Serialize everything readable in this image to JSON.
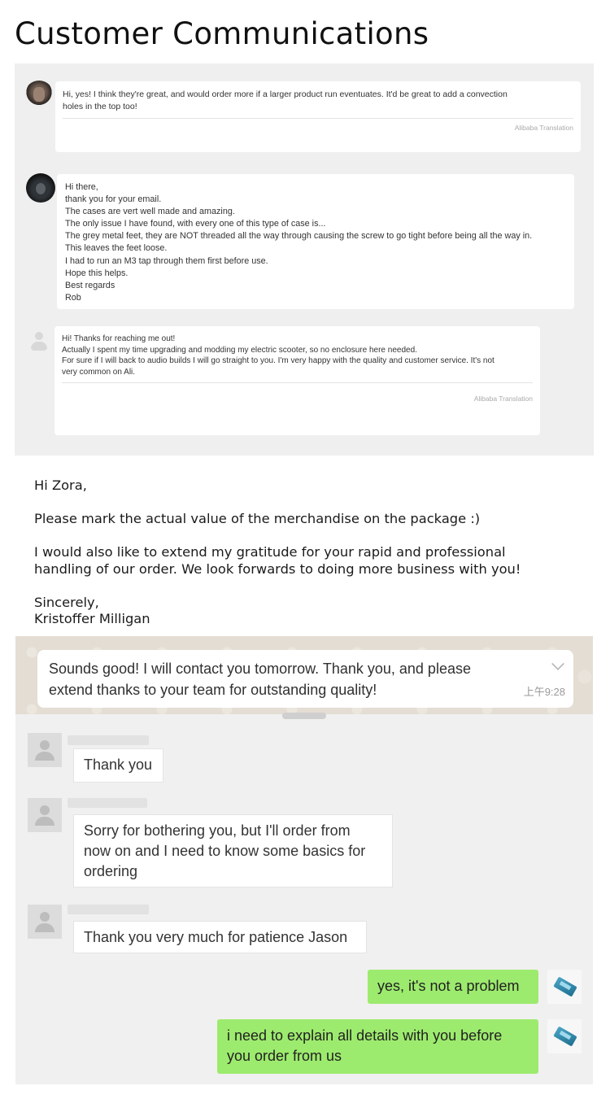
{
  "title": "Customer Communications",
  "alibaba_chat": {
    "messages": [
      {
        "lines": [
          "Hi, yes! I think they're great, and would order more if a larger product run eventuates. It'd be great to add a convection",
          "holes in the top too!"
        ],
        "translation_label": "Alibaba Translation"
      },
      {
        "lines": [
          "Hi there,",
          "thank you for your email.",
          "The cases are vert well made and amazing.",
          "The only issue I have found, with every one of this type of case is...",
          "The grey metal feet, they are NOT threaded all the way through  causing the screw to go tight before being all the way in.",
          "This leaves the feet loose.",
          "I had to run an M3 tap through them first before use.",
          "Hope this helps.",
          "Best regards",
          "Rob"
        ]
      },
      {
        "lines": [
          "Hi! Thanks for reaching me out!",
          "Actually I spent my time upgrading and modding my electric scooter, so no enclosure here needed.",
          "For sure if I will back to audio builds I will go straight to you. I'm very happy with the quality and customer service. It's not",
          "very common on Ali."
        ],
        "translation_label": "Alibaba Translation"
      }
    ]
  },
  "email": {
    "greeting": "Hi Zora,",
    "paragraph_1": "Please mark the actual value of the merchandise on the package :)",
    "paragraph_2_lines": [
      "I would also like to extend my gratitude for your rapid and professional",
      "handling of our order. We look forwards to doing more business with you!"
    ],
    "closing": "Sincerely,",
    "signature": "Kristoffer Milligan"
  },
  "whatsapp": {
    "message_lines": [
      "Sounds good!   I will contact you tomorrow.  Thank you, and please",
      "extend thanks to your team for outstanding quality!"
    ],
    "time": "上午9:28"
  },
  "chat": {
    "incoming": [
      {
        "lines": [
          "Thank you"
        ]
      },
      {
        "lines": [
          "Sorry for bothering you, but I'll order from",
          "now on and I need to know some basics for",
          "ordering"
        ]
      },
      {
        "lines": [
          "Thank you very much for patience Jason"
        ]
      }
    ],
    "outgoing": [
      {
        "lines": [
          "yes, it's not a problem"
        ]
      },
      {
        "lines": [
          "i need to explain all details with you before",
          "you order from us"
        ]
      }
    ]
  }
}
